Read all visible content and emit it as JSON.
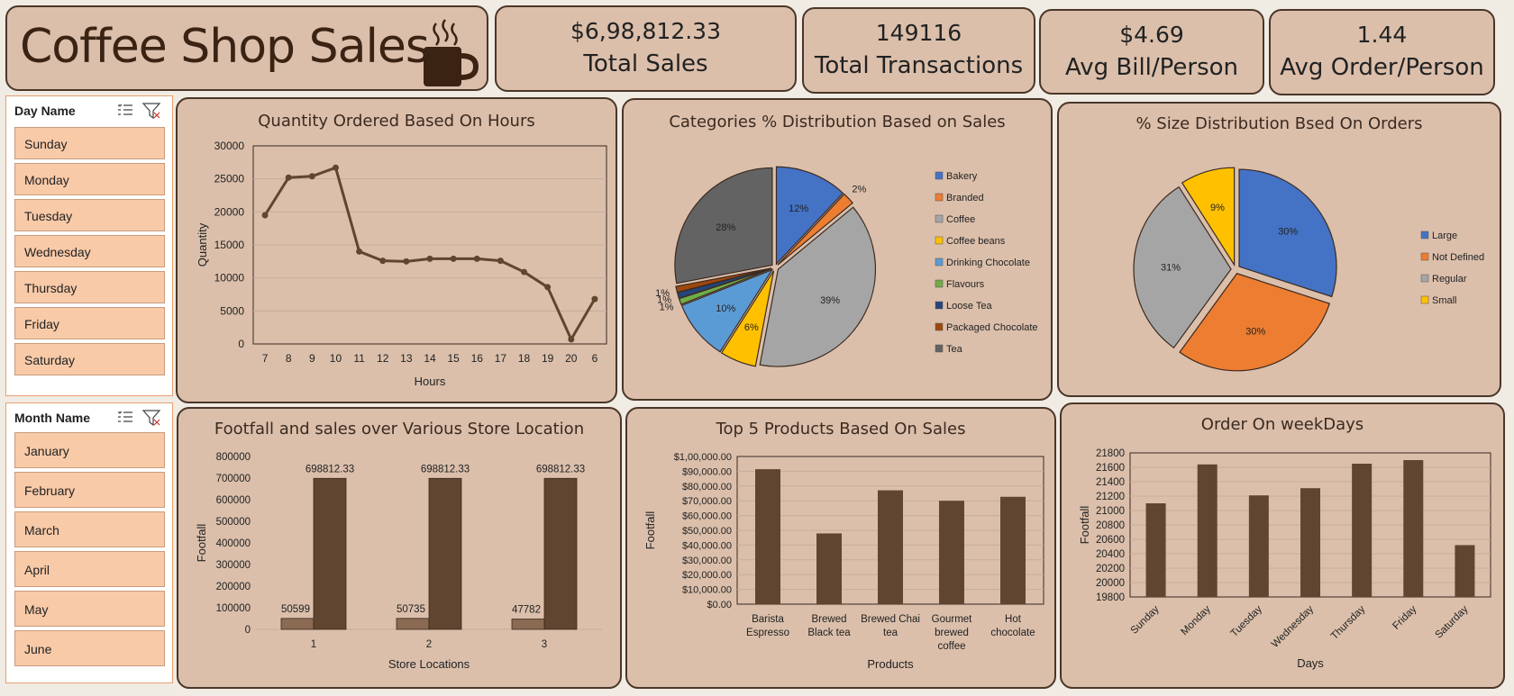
{
  "header": {
    "title": "Coffee Shop Sales",
    "kpis": [
      {
        "value": "$6,98,812.33",
        "label": "Total Sales"
      },
      {
        "value": "149116",
        "label": "Total Transactions"
      },
      {
        "value": "$4.69",
        "label": "Avg Bill/Person"
      },
      {
        "value": "1.44",
        "label": "Avg Order/Person"
      }
    ]
  },
  "slicers": {
    "day": {
      "title": "Day Name",
      "items": [
        "Sunday",
        "Monday",
        "Tuesday",
        "Wednesday",
        "Thursday",
        "Friday",
        "Saturday"
      ]
    },
    "month": {
      "title": "Month Name",
      "items": [
        "January",
        "February",
        "March",
        "April",
        "May",
        "June"
      ]
    }
  },
  "colors": {
    "brown": "#604530",
    "light_brown": "#8a6a52",
    "card": "#dbbfab"
  },
  "chart_data": [
    {
      "type": "line",
      "title": "Quantity Ordered Based On Hours",
      "xlabel": "Hours",
      "ylabel": "Quantity",
      "x": [
        "7",
        "8",
        "9",
        "10",
        "11",
        "12",
        "13",
        "14",
        "15",
        "16",
        "17",
        "18",
        "19",
        "20",
        "6"
      ],
      "values": [
        19500,
        25200,
        25400,
        26700,
        14000,
        12600,
        12500,
        12900,
        12900,
        12900,
        12600,
        10900,
        8600,
        700,
        6800
      ],
      "ylim": [
        0,
        30000
      ],
      "yticks": [
        "30000",
        "25000",
        "20000",
        "15000",
        "10000",
        "5000",
        "0"
      ],
      "grid": true
    },
    {
      "type": "pie",
      "title": "Categories % Distribution Based on Sales",
      "labels": [
        "Bakery",
        "Branded",
        "Coffee",
        "Coffee beans",
        "Drinking Chocolate",
        "Flavours",
        "Loose Tea",
        "Packaged Chocolate",
        "Tea"
      ],
      "values": [
        12,
        2,
        39,
        6,
        10,
        1,
        1,
        1,
        28
      ],
      "data_labels": [
        "12%",
        "2%",
        "39%",
        "6%",
        "10%",
        "1%",
        "1%",
        "1%",
        "28%"
      ],
      "colors": [
        "#4472c4",
        "#ed7d31",
        "#a5a5a5",
        "#ffc000",
        "#5b9bd5",
        "#70ad47",
        "#264478",
        "#9e480e",
        "#636363"
      ],
      "legend": "right"
    },
    {
      "type": "pie",
      "title": "% Size Distribution Bsed On Orders",
      "labels": [
        "Large",
        "Not Defined",
        "Regular",
        "Small"
      ],
      "values": [
        30,
        30,
        31,
        9
      ],
      "data_labels": [
        "30%",
        "30%",
        "31%",
        "9%"
      ],
      "colors": [
        "#4472c4",
        "#ed7d31",
        "#a5a5a5",
        "#ffc000"
      ],
      "legend": "right"
    },
    {
      "type": "bar",
      "title": "Footfall  and sales over Various Store  Location",
      "xlabel": "Store Locations",
      "ylabel": "Footfall",
      "categories": [
        "1",
        "2",
        "3"
      ],
      "series": [
        {
          "values": [
            50599,
            50735,
            47782
          ],
          "labels": [
            "50599",
            "50735",
            "47782"
          ]
        },
        {
          "values": [
            698812.33,
            698812.33,
            698812.33
          ],
          "labels": [
            "698812.33",
            "698812.33",
            "698812.33"
          ]
        }
      ],
      "ylim": [
        0,
        800000
      ],
      "yticks": [
        "800000",
        "700000",
        "600000",
        "500000",
        "400000",
        "300000",
        "200000",
        "100000",
        "0"
      ]
    },
    {
      "type": "bar",
      "title": "Top 5 Products Based On Sales",
      "xlabel": "Products",
      "ylabel": "Footfall",
      "categories": [
        [
          "Barista",
          "Espresso"
        ],
        [
          "Brewed",
          "Black tea"
        ],
        [
          "Brewed Chai",
          "tea"
        ],
        [
          "Gourmet",
          "brewed",
          "coffee"
        ],
        [
          "Hot",
          "chocolate"
        ]
      ],
      "values": [
        91400,
        47900,
        77100,
        70000,
        72700
      ],
      "ylim": [
        0,
        100000
      ],
      "yticks": [
        "$1,00,000.00",
        "$90,000.00",
        "$80,000.00",
        "$70,000.00",
        "$60,000.00",
        "$50,000.00",
        "$40,000.00",
        "$30,000.00",
        "$20,000.00",
        "$10,000.00",
        "$0.00"
      ],
      "grid": true
    },
    {
      "type": "bar",
      "title": "Order On weekDays",
      "xlabel": "Days",
      "ylabel": "Footfall",
      "categories": [
        "Sunday",
        "Monday",
        "Tuesday",
        "Wednesday",
        "Thursday",
        "Friday",
        "Saturday"
      ],
      "values": [
        21100,
        21640,
        21210,
        21310,
        21650,
        21700,
        20520
      ],
      "ylim": [
        19800,
        21800
      ],
      "yticks": [
        "21800",
        "21600",
        "21400",
        "21200",
        "21000",
        "20800",
        "20600",
        "20400",
        "20200",
        "20000",
        "19800"
      ],
      "grid": true
    }
  ]
}
